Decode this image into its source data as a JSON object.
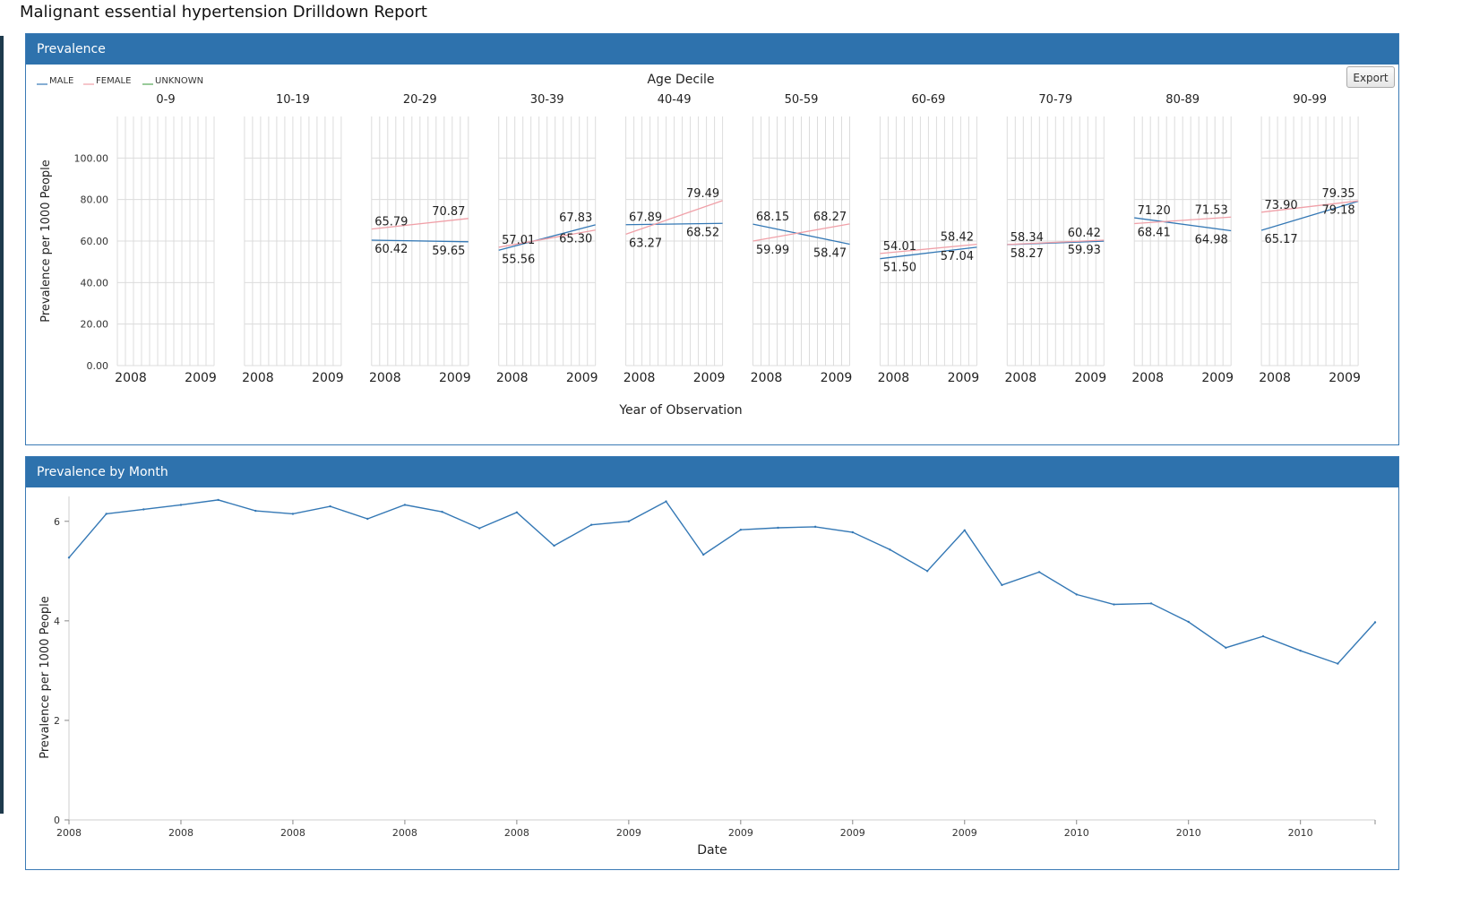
{
  "report": {
    "title": "Malignant essential hypertension Drilldown Report"
  },
  "prevalence_panel": {
    "header": "Prevalence",
    "export_label": "Export",
    "facet_title": "Age Decile",
    "legend": [
      {
        "label": "MALE",
        "color": "#3478b5"
      },
      {
        "label": "FEMALE",
        "color": "#f0a0a8"
      },
      {
        "label": "UNKNOWN",
        "color": "#55a857"
      }
    ]
  },
  "month_panel": {
    "header": "Prevalence by Month"
  },
  "chart_data": [
    {
      "type": "line",
      "title": "Age Decile",
      "xlabel": "Year of Observation",
      "ylabel": "Prevalence per 1000 People",
      "ylim": [
        0,
        120
      ],
      "y_ticks": [
        "0.00",
        "20.00",
        "40.00",
        "60.00",
        "80.00",
        "100.00"
      ],
      "x_ticks": [
        "2008",
        "2009"
      ],
      "grid": true,
      "legend_position": "top-left",
      "facets": [
        {
          "label": "0-9",
          "series": []
        },
        {
          "label": "10-19",
          "series": []
        },
        {
          "label": "20-29",
          "series": [
            {
              "name": "MALE",
              "x": [
                "2008",
                "2009"
              ],
              "values": [
                60.42,
                59.65
              ],
              "labels": [
                "60.42",
                "59.65"
              ]
            },
            {
              "name": "FEMALE",
              "x": [
                "2008",
                "2009"
              ],
              "values": [
                65.79,
                70.87
              ],
              "labels": [
                "65.79",
                "70.87"
              ]
            }
          ]
        },
        {
          "label": "30-39",
          "series": [
            {
              "name": "MALE",
              "x": [
                "2008",
                "2009"
              ],
              "values": [
                55.56,
                67.83
              ],
              "labels": [
                "55.56",
                "67.83"
              ]
            },
            {
              "name": "FEMALE",
              "x": [
                "2008",
                "2009"
              ],
              "values": [
                57.01,
                65.3
              ],
              "labels": [
                "57.01",
                "65.30"
              ]
            }
          ]
        },
        {
          "label": "40-49",
          "series": [
            {
              "name": "MALE",
              "x": [
                "2008",
                "2009"
              ],
              "values": [
                67.89,
                68.52
              ],
              "labels": [
                "67.89",
                "68.52"
              ]
            },
            {
              "name": "FEMALE",
              "x": [
                "2008",
                "2009"
              ],
              "values": [
                63.27,
                79.49
              ],
              "labels": [
                "63.27",
                "79.49"
              ]
            }
          ]
        },
        {
          "label": "50-59",
          "series": [
            {
              "name": "MALE",
              "x": [
                "2008",
                "2009"
              ],
              "values": [
                68.15,
                58.47
              ],
              "labels": [
                "68.15",
                "58.47"
              ]
            },
            {
              "name": "FEMALE",
              "x": [
                "2008",
                "2009"
              ],
              "values": [
                59.99,
                68.27
              ],
              "labels": [
                "59.99",
                "68.27"
              ]
            }
          ]
        },
        {
          "label": "60-69",
          "series": [
            {
              "name": "MALE",
              "x": [
                "2008",
                "2009"
              ],
              "values": [
                51.5,
                57.04
              ],
              "labels": [
                "51.50",
                "57.04"
              ]
            },
            {
              "name": "FEMALE",
              "x": [
                "2008",
                "2009"
              ],
              "values": [
                54.01,
                58.42
              ],
              "labels": [
                "54.01",
                "58.42"
              ]
            }
          ]
        },
        {
          "label": "70-79",
          "series": [
            {
              "name": "MALE",
              "x": [
                "2008",
                "2009"
              ],
              "values": [
                58.27,
                59.93
              ],
              "labels": [
                "58.27",
                "59.93"
              ]
            },
            {
              "name": "FEMALE",
              "x": [
                "2008",
                "2009"
              ],
              "values": [
                58.34,
                60.42
              ],
              "labels": [
                "58.34",
                "60.42"
              ]
            }
          ]
        },
        {
          "label": "80-89",
          "series": [
            {
              "name": "MALE",
              "x": [
                "2008",
                "2009"
              ],
              "values": [
                71.2,
                64.98
              ],
              "labels": [
                "71.20",
                "64.98"
              ]
            },
            {
              "name": "FEMALE",
              "x": [
                "2008",
                "2009"
              ],
              "values": [
                68.41,
                71.53
              ],
              "labels": [
                "68.41",
                "71.53"
              ]
            }
          ]
        },
        {
          "label": "90-99",
          "series": [
            {
              "name": "MALE",
              "x": [
                "2008",
                "2009"
              ],
              "values": [
                65.17,
                79.18
              ],
              "labels": [
                "65.17",
                "79.18"
              ]
            },
            {
              "name": "FEMALE",
              "x": [
                "2008",
                "2009"
              ],
              "values": [
                73.9,
                79.35
              ],
              "labels": [
                "73.90",
                "79.35"
              ]
            }
          ]
        }
      ]
    },
    {
      "type": "line",
      "title": "Prevalence by Month",
      "xlabel": "Date",
      "ylabel": "Prevalence per 1000 People",
      "ylim": [
        0,
        6.5
      ],
      "y_ticks": [
        "0",
        "2",
        "4",
        "6"
      ],
      "x_tick_labels": [
        "2008",
        "2008",
        "2008",
        "2008",
        "2008",
        "2009",
        "2009",
        "2009",
        "2009",
        "2010",
        "2010",
        "2010",
        "2010"
      ],
      "x": [
        "2008-01",
        "2008-02",
        "2008-03",
        "2008-04",
        "2008-05",
        "2008-06",
        "2008-07",
        "2008-08",
        "2008-09",
        "2008-10",
        "2008-11",
        "2008-12",
        "2009-01",
        "2009-02",
        "2009-03",
        "2009-04",
        "2009-05",
        "2009-06",
        "2009-07",
        "2009-08",
        "2009-09",
        "2009-10",
        "2009-11",
        "2009-12",
        "2010-01",
        "2010-02",
        "2010-03",
        "2010-04",
        "2010-05",
        "2010-06",
        "2010-07",
        "2010-08",
        "2010-09",
        "2010-10",
        "2010-11",
        "2010-12"
      ],
      "series": [
        {
          "color": "#3478b5",
          "values": [
            5.27,
            6.15,
            6.24,
            6.33,
            6.43,
            6.21,
            6.15,
            6.3,
            6.05,
            6.33,
            6.19,
            5.86,
            6.18,
            5.51,
            5.93,
            6.0,
            6.4,
            5.33,
            5.83,
            5.87,
            5.89,
            5.78,
            5.43,
            5.0,
            5.82,
            4.72,
            4.98,
            4.53,
            4.33,
            4.35,
            3.98,
            3.46,
            3.69,
            3.4,
            3.14,
            3.97
          ]
        }
      ]
    }
  ]
}
